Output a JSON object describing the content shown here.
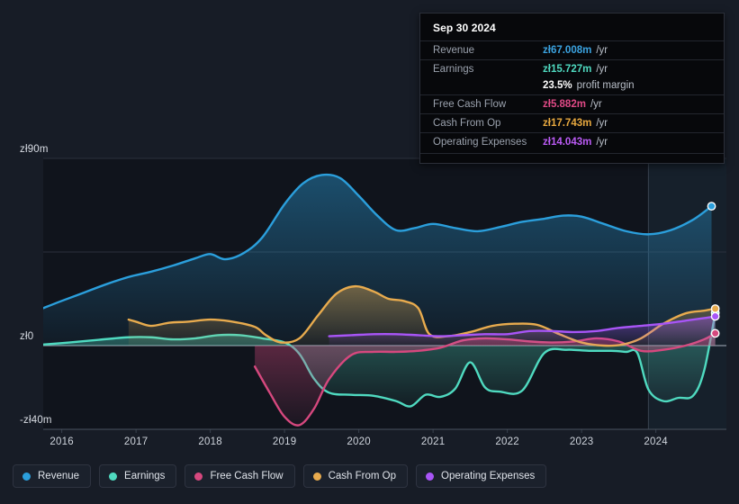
{
  "chart_data": {
    "type": "area",
    "title": "",
    "xlabel": "",
    "ylabel": "",
    "currency_prefix": "zł",
    "unit_suffix": "m",
    "ylim": [
      -40,
      90
    ],
    "y_ticks": [
      {
        "value": 90,
        "label": "zł90m"
      },
      {
        "value": 45,
        "label": ""
      },
      {
        "value": 0,
        "label": "zł0"
      },
      {
        "value": -40,
        "label": "-zł40m"
      }
    ],
    "x_ticks": [
      "2016",
      "2017",
      "2018",
      "2019",
      "2020",
      "2021",
      "2022",
      "2023",
      "2024"
    ],
    "xlim": [
      2015.75,
      2024.95
    ],
    "grid": true,
    "legend_position": "bottom",
    "forecast_start": 2023.9,
    "series": [
      {
        "name": "Revenue",
        "color": "#2b9fdc",
        "x": [
          2015.75,
          2016.0,
          2016.3,
          2016.6,
          2016.9,
          2017.2,
          2017.5,
          2017.8,
          2018.0,
          2018.2,
          2018.45,
          2018.7,
          2019.0,
          2019.25,
          2019.5,
          2019.75,
          2020.0,
          2020.25,
          2020.5,
          2020.75,
          2021.0,
          2021.3,
          2021.6,
          2021.9,
          2022.2,
          2022.5,
          2022.75,
          2023.0,
          2023.3,
          2023.6,
          2023.9,
          2024.2,
          2024.5,
          2024.75
        ],
        "y": [
          18.0,
          21.5,
          25.5,
          29.5,
          33.0,
          35.5,
          38.5,
          42.0,
          44.0,
          41.5,
          44.5,
          52.0,
          68.0,
          78.0,
          82.0,
          80.5,
          72.0,
          62.5,
          55.5,
          56.5,
          58.5,
          56.5,
          55.0,
          57.0,
          59.5,
          61.0,
          62.5,
          62.0,
          58.5,
          55.0,
          53.5,
          55.5,
          60.5,
          67.008
        ]
      },
      {
        "name": "Earnings",
        "color": "#4fdac0",
        "x": [
          2015.75,
          2016.1,
          2016.5,
          2016.9,
          2017.2,
          2017.5,
          2017.8,
          2018.1,
          2018.4,
          2018.7,
          2019.0,
          2019.2,
          2019.4,
          2019.6,
          2019.9,
          2020.2,
          2020.5,
          2020.7,
          2020.9,
          2021.1,
          2021.3,
          2021.5,
          2021.7,
          2021.9,
          2022.2,
          2022.5,
          2022.8,
          2023.1,
          2023.4,
          2023.6,
          2023.75,
          2023.9,
          2024.1,
          2024.3,
          2024.5,
          2024.65,
          2024.8
        ],
        "y": [
          0.5,
          1.5,
          2.8,
          4.0,
          4.0,
          3.0,
          3.5,
          5.0,
          5.0,
          3.5,
          1.5,
          -4.0,
          -16.0,
          -22.5,
          -23.5,
          -24.0,
          -26.5,
          -29.0,
          -23.5,
          -24.5,
          -20.5,
          -8.0,
          -20.0,
          -22.0,
          -21.5,
          -3.5,
          -2.0,
          -2.5,
          -2.5,
          -3.0,
          -3.5,
          -21.0,
          -26.5,
          -25.0,
          -24.0,
          -12.0,
          15.727
        ]
      },
      {
        "name": "Free Cash Flow",
        "color": "#d6487e",
        "x": [
          2018.6,
          2018.8,
          2019.0,
          2019.2,
          2019.4,
          2019.6,
          2019.9,
          2020.2,
          2020.5,
          2020.8,
          2021.1,
          2021.4,
          2021.7,
          2022.0,
          2022.3,
          2022.6,
          2022.9,
          2023.2,
          2023.5,
          2023.8,
          2024.1,
          2024.4,
          2024.65,
          2024.8
        ],
        "y": [
          -10.0,
          -22.5,
          -34.0,
          -38.0,
          -30.0,
          -16.0,
          -4.5,
          -3.0,
          -3.0,
          -2.5,
          -1.0,
          2.5,
          3.5,
          3.0,
          2.0,
          1.5,
          2.0,
          3.5,
          2.0,
          -2.5,
          -2.0,
          0.0,
          3.0,
          5.882
        ]
      },
      {
        "name": "Cash From Op",
        "color": "#e8ab4e",
        "x": [
          2016.9,
          2017.0,
          2017.2,
          2017.45,
          2017.7,
          2018.0,
          2018.3,
          2018.6,
          2018.75,
          2018.95,
          2019.2,
          2019.45,
          2019.7,
          2019.95,
          2020.2,
          2020.4,
          2020.6,
          2020.8,
          2020.95,
          2021.2,
          2021.5,
          2021.8,
          2022.1,
          2022.4,
          2022.7,
          2023.0,
          2023.3,
          2023.55,
          2023.8,
          2024.1,
          2024.4,
          2024.65,
          2024.8
        ],
        "y": [
          12.5,
          11.5,
          9.5,
          11.0,
          11.5,
          12.5,
          11.5,
          9.0,
          5.0,
          1.5,
          3.5,
          14.5,
          25.0,
          28.5,
          26.0,
          22.5,
          21.5,
          18.0,
          5.5,
          4.5,
          6.5,
          9.5,
          10.5,
          10.0,
          5.5,
          1.5,
          0.0,
          0.5,
          3.5,
          10.5,
          15.5,
          16.8,
          17.743
        ]
      },
      {
        "name": "Operating Expenses",
        "color": "#a855f7",
        "x": [
          2019.6,
          2019.9,
          2020.2,
          2020.5,
          2020.8,
          2021.1,
          2021.4,
          2021.7,
          2022.0,
          2022.3,
          2022.6,
          2022.9,
          2023.2,
          2023.5,
          2023.8,
          2024.1,
          2024.4,
          2024.65,
          2024.8
        ],
        "y": [
          4.5,
          5.0,
          5.5,
          5.5,
          5.0,
          4.5,
          5.0,
          5.5,
          5.5,
          7.0,
          7.0,
          6.5,
          7.0,
          8.5,
          9.5,
          10.5,
          12.0,
          13.2,
          14.043
        ]
      }
    ]
  },
  "tooltip": {
    "title": "Sep 30 2024",
    "rows": [
      {
        "label": "Revenue",
        "value": "zł67.008m",
        "unit": "/yr",
        "color": "#3ba3e0"
      },
      {
        "label": "Earnings",
        "value": "zł15.727m",
        "unit": "/yr",
        "color": "#4fdac0"
      },
      {
        "label": "Free Cash Flow",
        "value": "zł5.882m",
        "unit": "/yr",
        "color": "#e04a86"
      },
      {
        "label": "Cash From Op",
        "value": "zł17.743m",
        "unit": "/yr",
        "color": "#e8a93f"
      },
      {
        "label": "Operating Expenses",
        "value": "zł14.043m",
        "unit": "/yr",
        "color": "#bb5bf5"
      }
    ],
    "margin_value": "23.5%",
    "margin_text": "profit margin"
  },
  "legend": {
    "items": [
      {
        "label": "Revenue",
        "color": "#2b9fdc"
      },
      {
        "label": "Earnings",
        "color": "#4fdac0"
      },
      {
        "label": "Free Cash Flow",
        "color": "#d6487e"
      },
      {
        "label": "Cash From Op",
        "color": "#e8ab4e"
      },
      {
        "label": "Operating Expenses",
        "color": "#a855f7"
      }
    ]
  }
}
